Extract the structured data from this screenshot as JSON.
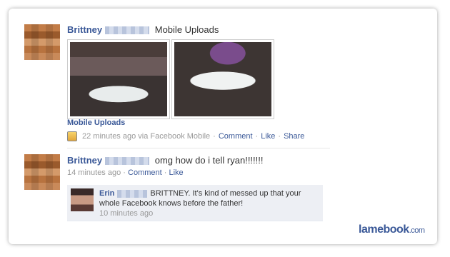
{
  "post": {
    "author": "Brittney",
    "story": "Mobile Uploads",
    "album_link": "Mobile Uploads",
    "time": "22 minutes ago via Facebook Mobile",
    "actions": [
      "Comment",
      "Like",
      "Share"
    ]
  },
  "status": {
    "author": "Brittney",
    "message": "omg how do i tell ryan!!!!!!!",
    "time": "14 minutes ago",
    "actions": [
      "Comment",
      "Like"
    ]
  },
  "comment": {
    "author": "Erin",
    "text": "BRITTNEY. It's kind of messed up that your whole Facebook knows before the father!",
    "time": "10 minutes ago"
  },
  "watermark": {
    "name": "lamebook",
    "suffix": ".com"
  },
  "colors": {
    "link": "#3b5998",
    "muted": "#999999",
    "comment_bg": "#edeff4"
  }
}
